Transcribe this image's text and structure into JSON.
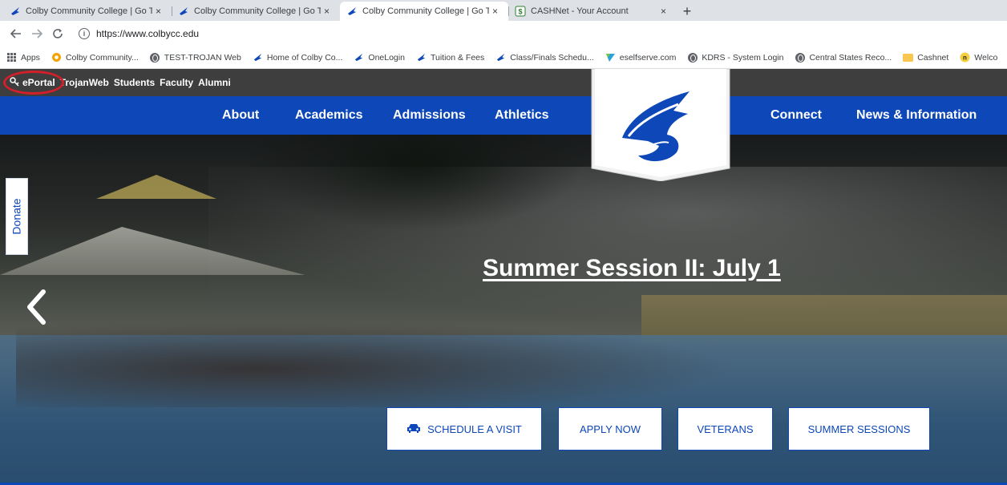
{
  "browser": {
    "tabs": [
      {
        "title": "Colby Community College | Go T",
        "active": false
      },
      {
        "title": "Colby Community College | Go T",
        "active": false
      },
      {
        "title": "Colby Community College | Go T",
        "active": true
      },
      {
        "title": "CASHNet - Your Account",
        "active": false
      }
    ],
    "new_tab_label": "+",
    "close_glyph": "×",
    "url": "https://www.colbycc.edu",
    "bookmarks": [
      {
        "label": "Apps",
        "icon": "apps-grid-icon"
      },
      {
        "label": "Colby Community...",
        "icon": "lifebuoy-icon"
      },
      {
        "label": "TEST-TROJAN Web",
        "icon": "globe-icon"
      },
      {
        "label": "Home of Colby Co...",
        "icon": "trojan-icon"
      },
      {
        "label": "OneLogin",
        "icon": "trojan-icon"
      },
      {
        "label": "Tuition & Fees",
        "icon": "trojan-icon"
      },
      {
        "label": "Class/Finals Schedu...",
        "icon": "trojan-icon"
      },
      {
        "label": "eselfserve.com",
        "icon": "eselfserve-icon"
      },
      {
        "label": "KDRS - System Login",
        "icon": "globe-icon"
      },
      {
        "label": "Central States Reco...",
        "icon": "globe-icon"
      },
      {
        "label": "Cashnet",
        "icon": "folder-icon"
      },
      {
        "label": "Welco",
        "icon": "n-badge-icon"
      }
    ]
  },
  "site": {
    "utility_links": [
      "ePortal",
      "TrojanWeb",
      "Students",
      "Faculty",
      "Alumni"
    ],
    "main_nav": [
      "About",
      "Academics",
      "Admissions",
      "Athletics",
      "Connect",
      "News & Information"
    ],
    "donate_label": "Donate",
    "headline": "Summer Session II: July 1",
    "cta_buttons": [
      "SCHEDULE A VISIT",
      "APPLY NOW",
      "VETERANS",
      "SUMMER SESSIONS"
    ]
  },
  "colors": {
    "nav_blue": "#0d47b8",
    "utility_gray": "#3e3e3e",
    "highlight_red": "#d0202a"
  }
}
